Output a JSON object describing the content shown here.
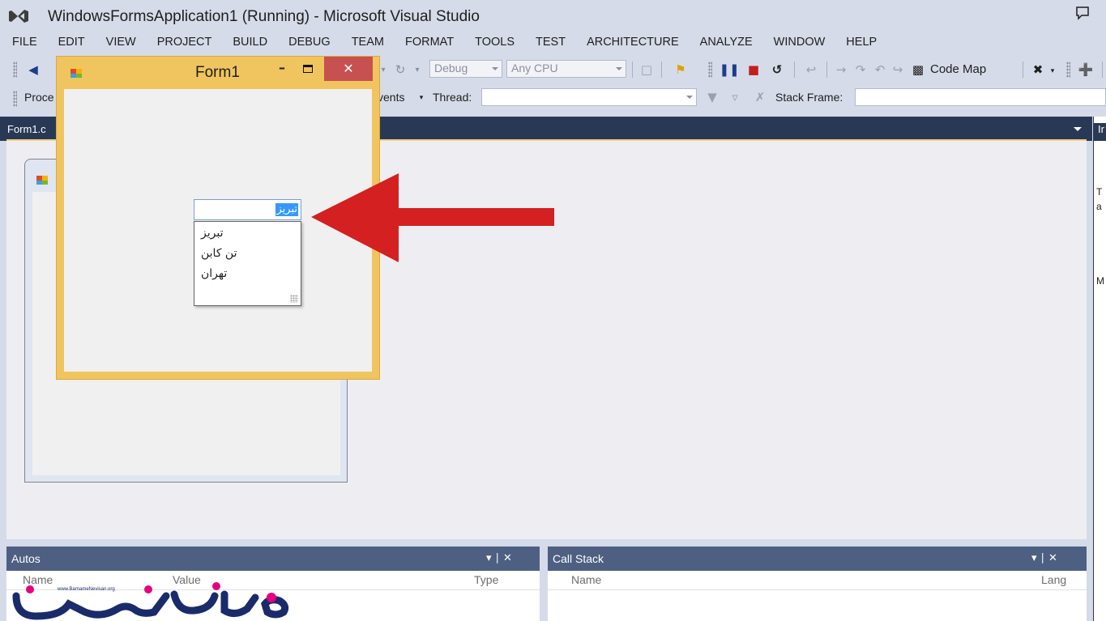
{
  "window": {
    "title": "WindowsFormsApplication1 (Running) - Microsoft Visual Studio"
  },
  "menu": [
    "FILE",
    "EDIT",
    "VIEW",
    "PROJECT",
    "BUILD",
    "DEBUG",
    "TEAM",
    "FORMAT",
    "TOOLS",
    "TEST",
    "ARCHITECTURE",
    "ANALYZE",
    "WINDOW",
    "HELP"
  ],
  "toolbar": {
    "config": "Debug",
    "platform": "Any CPU",
    "code_map": "Code Map",
    "process_label": "Proce",
    "events_label": "vents",
    "thread_label": "Thread:",
    "stack_frame_label": "Stack Frame:"
  },
  "editor": {
    "tab": "Form1.c"
  },
  "right_panel": {
    "header": "Ir",
    "lines": [
      "T",
      "a",
      "M"
    ]
  },
  "form1": {
    "title": "Form1",
    "combo_text": "تبريز",
    "items": [
      "تبريز",
      "تن كابن",
      "تهران"
    ]
  },
  "autos": {
    "title": "Autos",
    "columns": [
      "Name",
      "Value",
      "Type"
    ]
  },
  "callstack": {
    "title": "Call Stack",
    "columns": [
      "Name",
      "Lang"
    ]
  },
  "watermark": {
    "url": "www.BarnameNevisan.org"
  },
  "colors": {
    "accent": "#293955",
    "form_border": "#f0c55f",
    "close_button": "#c75050",
    "arrow": "#d42020",
    "selection": "#3399ff"
  }
}
